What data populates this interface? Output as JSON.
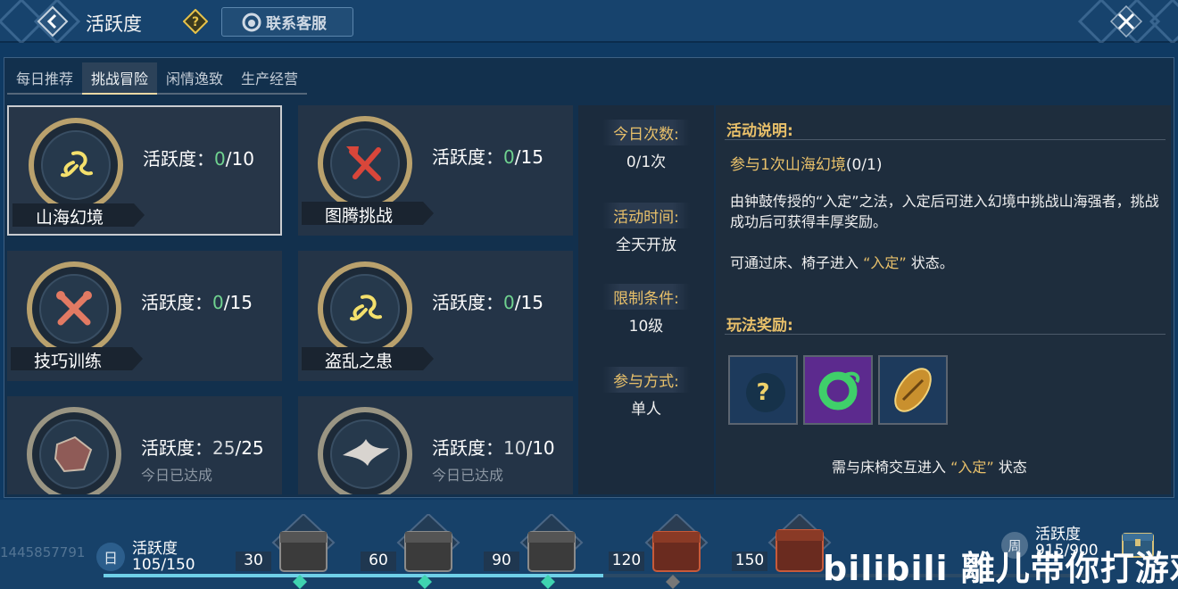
{
  "header": {
    "title": "活跃度",
    "service_label": "联系客服"
  },
  "tabs": [
    {
      "label": "每日推荐",
      "active": false
    },
    {
      "label": "挑战冒险",
      "active": true
    },
    {
      "label": "闲情逸致",
      "active": false
    },
    {
      "label": "生产经营",
      "active": false
    }
  ],
  "activities": [
    {
      "name": "山海幻境",
      "label": "活跃度：",
      "current": "0",
      "max": "/10",
      "achieved": "",
      "icon": "squid-icon"
    },
    {
      "name": "图腾挑战",
      "label": "活跃度：",
      "current": "0",
      "max": "/15",
      "achieved": "",
      "icon": "axe-sword-icon"
    },
    {
      "name": "技巧训练",
      "label": "活跃度：",
      "current": "0",
      "max": "/15",
      "achieved": "",
      "icon": "crossed-tools-icon"
    },
    {
      "name": "盗乱之患",
      "label": "活跃度：",
      "current": "0",
      "max": "/15",
      "achieved": "",
      "icon": "squid-icon"
    },
    {
      "name": "",
      "label": "活跃度：",
      "current": "25",
      "max": "/25",
      "achieved": "今日已达成",
      "icon": "beast-icon"
    },
    {
      "name": "",
      "label": "活跃度：",
      "current": "10",
      "max": "/10",
      "achieved": "今日已达成",
      "icon": "bird-icon"
    }
  ],
  "info": {
    "count_label": "今日次数:",
    "count_value": "0/1次",
    "time_label": "活动时间:",
    "time_value": "全天开放",
    "limit_label": "限制条件:",
    "limit_value": "10级",
    "mode_label": "参与方式:",
    "mode_value": "单人"
  },
  "description": {
    "heading": "活动说明:",
    "task": "参与1次山海幻境",
    "task_progress": "(0/1)",
    "text_1": "由钟鼓传授的“入定”之法，入定后可进入幻境中挑战山海强者，挑战成功后可获得丰厚奖励。",
    "text_2_prefix": "可通过床、椅子进入",
    "text_2_highlight": "“入定”",
    "text_2_suffix": "状态。",
    "reward_heading": "玩法奖励:",
    "rewards": [
      {
        "name": "mystery-reward-icon",
        "bg": "#1d3a5c"
      },
      {
        "name": "jade-ring-icon",
        "bg": "#5c2a8e"
      },
      {
        "name": "gold-shell-icon",
        "bg": "#1d3a5c"
      }
    ],
    "note_prefix": "需与床椅交互进入",
    "note_highlight": "“入定”",
    "note_suffix": "状态"
  },
  "bottom": {
    "uid": "1445857791",
    "day_badge": "日",
    "day_label": "活跃度",
    "day_value": "105/150",
    "day_progress": 0.7,
    "milestones": [
      "30",
      "60",
      "90",
      "120",
      "150"
    ],
    "week_badge": "周",
    "week_label": "活跃度",
    "week_value": "915/900"
  },
  "watermark": "bilibili 離儿带你打游戏",
  "colors": {
    "accent_gold": "#e8c06a",
    "progress_green": "#6fd28f",
    "progress_bar": "#6fd0e8"
  }
}
